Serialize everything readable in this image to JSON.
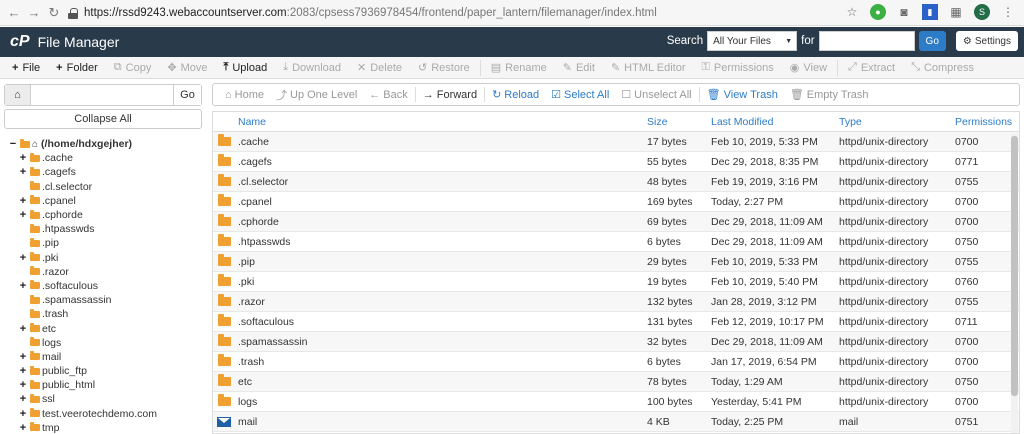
{
  "browser": {
    "url_host": "https://rssd9243.webaccountserver.com",
    "url_path": ":2083/cpsess7936978454/frontend/paper_lantern/filemanager/index.html",
    "avatar_letter": "S"
  },
  "header": {
    "logo": "cP",
    "title": "File Manager",
    "search_label": "Search",
    "search_select": "All Your Files",
    "for_label": "for",
    "go_label": "Go",
    "settings_label": "Settings"
  },
  "toolbar": {
    "items": [
      {
        "label": "File",
        "icon": "+"
      },
      {
        "label": "Folder",
        "icon": "+"
      },
      {
        "label": "Copy",
        "icon": "⧉"
      },
      {
        "label": "Move",
        "icon": "✥"
      },
      {
        "label": "Upload",
        "icon": "⤒"
      },
      {
        "label": "Download",
        "icon": "⤓"
      },
      {
        "label": "Delete",
        "icon": "✕"
      },
      {
        "label": "Restore",
        "icon": "↺"
      },
      {
        "label": "Rename",
        "icon": "▤"
      },
      {
        "label": "Edit",
        "icon": "✎"
      },
      {
        "label": "HTML Editor",
        "icon": "✎"
      },
      {
        "label": "Permissions",
        "icon": "⚿"
      },
      {
        "label": "View",
        "icon": "◉"
      },
      {
        "label": "Extract",
        "icon": "⤢"
      },
      {
        "label": "Compress",
        "icon": "⤡"
      }
    ]
  },
  "left": {
    "go_label": "Go",
    "collapse_label": "Collapse All",
    "root": "(/home/hdxgejher)",
    "tree": [
      {
        "name": ".cache",
        "expand": true
      },
      {
        "name": ".cagefs",
        "expand": true
      },
      {
        "name": ".cl.selector",
        "expand": false
      },
      {
        "name": ".cpanel",
        "expand": true
      },
      {
        "name": ".cphorde",
        "expand": true
      },
      {
        "name": ".htpasswds",
        "expand": false
      },
      {
        "name": ".pip",
        "expand": false
      },
      {
        "name": ".pki",
        "expand": true
      },
      {
        "name": ".razor",
        "expand": false
      },
      {
        "name": ".softaculous",
        "expand": true
      },
      {
        "name": ".spamassassin",
        "expand": false
      },
      {
        "name": ".trash",
        "expand": false
      },
      {
        "name": "etc",
        "expand": true
      },
      {
        "name": "logs",
        "expand": false
      },
      {
        "name": "mail",
        "expand": true
      },
      {
        "name": "public_ftp",
        "expand": true
      },
      {
        "name": "public_html",
        "expand": true
      },
      {
        "name": "ssl",
        "expand": true
      },
      {
        "name": "test.veerotechdemo.com",
        "expand": true
      },
      {
        "name": "tmp",
        "expand": true
      }
    ]
  },
  "navbar": {
    "items": [
      {
        "label": "Home",
        "icon": "⌂",
        "state": "disabled"
      },
      {
        "label": "Up One Level",
        "icon": "⤴",
        "state": "disabled"
      },
      {
        "label": "Back",
        "icon": "←",
        "state": "disabled"
      },
      {
        "label": "Forward",
        "icon": "→",
        "state": "normal"
      },
      {
        "label": "Reload",
        "icon": "↻",
        "state": "link"
      },
      {
        "label": "Select All",
        "icon": "☑",
        "state": "link"
      },
      {
        "label": "Unselect All",
        "icon": "☐",
        "state": "disabled"
      },
      {
        "label": "View Trash",
        "icon": "🗑",
        "state": "link"
      },
      {
        "label": "Empty Trash",
        "icon": "🗑",
        "state": "disabled"
      }
    ]
  },
  "table": {
    "headers": {
      "name": "Name",
      "size": "Size",
      "modified": "Last Modified",
      "type": "Type",
      "perms": "Permissions"
    },
    "rows": [
      {
        "name": ".cache",
        "size": "17 bytes",
        "modified": "Feb 10, 2019, 5:33 PM",
        "type": "httpd/unix-directory",
        "perms": "0700",
        "icon": "folder"
      },
      {
        "name": ".cagefs",
        "size": "55 bytes",
        "modified": "Dec 29, 2018, 8:35 PM",
        "type": "httpd/unix-directory",
        "perms": "0771",
        "icon": "folder"
      },
      {
        "name": ".cl.selector",
        "size": "48 bytes",
        "modified": "Feb 19, 2019, 3:16 PM",
        "type": "httpd/unix-directory",
        "perms": "0755",
        "icon": "folder"
      },
      {
        "name": ".cpanel",
        "size": "169 bytes",
        "modified": "Today, 2:27 PM",
        "type": "httpd/unix-directory",
        "perms": "0700",
        "icon": "folder"
      },
      {
        "name": ".cphorde",
        "size": "69 bytes",
        "modified": "Dec 29, 2018, 11:09 AM",
        "type": "httpd/unix-directory",
        "perms": "0700",
        "icon": "folder"
      },
      {
        "name": ".htpasswds",
        "size": "6 bytes",
        "modified": "Dec 29, 2018, 11:09 AM",
        "type": "httpd/unix-directory",
        "perms": "0750",
        "icon": "folder"
      },
      {
        "name": ".pip",
        "size": "29 bytes",
        "modified": "Feb 10, 2019, 5:33 PM",
        "type": "httpd/unix-directory",
        "perms": "0755",
        "icon": "folder"
      },
      {
        "name": ".pki",
        "size": "19 bytes",
        "modified": "Feb 10, 2019, 5:40 PM",
        "type": "httpd/unix-directory",
        "perms": "0760",
        "icon": "folder"
      },
      {
        "name": ".razor",
        "size": "132 bytes",
        "modified": "Jan 28, 2019, 3:12 PM",
        "type": "httpd/unix-directory",
        "perms": "0755",
        "icon": "folder"
      },
      {
        "name": ".softaculous",
        "size": "131 bytes",
        "modified": "Feb 12, 2019, 10:17 PM",
        "type": "httpd/unix-directory",
        "perms": "0711",
        "icon": "folder"
      },
      {
        "name": ".spamassassin",
        "size": "32 bytes",
        "modified": "Dec 29, 2018, 11:09 AM",
        "type": "httpd/unix-directory",
        "perms": "0700",
        "icon": "folder"
      },
      {
        "name": ".trash",
        "size": "6 bytes",
        "modified": "Jan 17, 2019, 6:54 PM",
        "type": "httpd/unix-directory",
        "perms": "0700",
        "icon": "folder"
      },
      {
        "name": "etc",
        "size": "78 bytes",
        "modified": "Today, 1:29 AM",
        "type": "httpd/unix-directory",
        "perms": "0750",
        "icon": "folder"
      },
      {
        "name": "logs",
        "size": "100 bytes",
        "modified": "Yesterday, 5:41 PM",
        "type": "httpd/unix-directory",
        "perms": "0700",
        "icon": "folder"
      },
      {
        "name": "mail",
        "size": "4 KB",
        "modified": "Today, 2:25 PM",
        "type": "mail",
        "perms": "0751",
        "icon": "mail"
      }
    ]
  }
}
